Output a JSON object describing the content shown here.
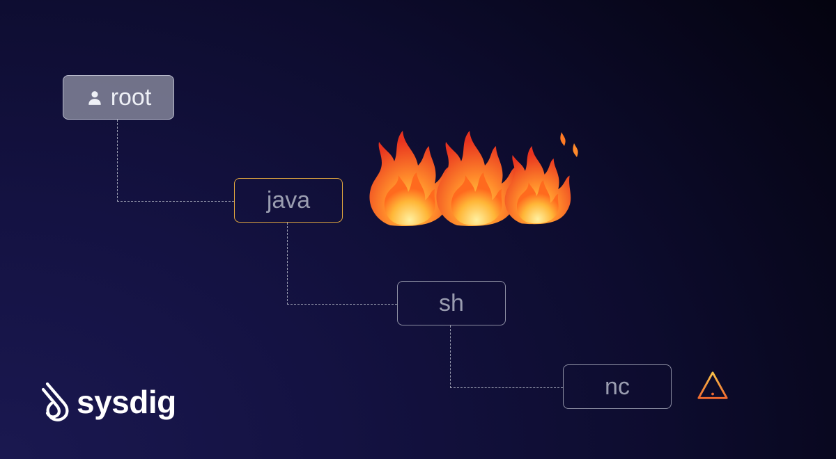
{
  "diagram": {
    "nodes": {
      "root": {
        "label": "root"
      },
      "java": {
        "label": "java"
      },
      "sh": {
        "label": "sh"
      },
      "nc": {
        "label": "nc"
      }
    },
    "icons": {
      "user": "user-icon",
      "fire": "fire-icon",
      "warning": "warning-icon"
    },
    "colors": {
      "background_deep": "#020108",
      "background_light": "#1a1850",
      "node_border_plain": "#8d8fa3",
      "node_border_highlight": "#e3a83f",
      "node_text": "#9a9db0",
      "root_fill": "#9194a5",
      "connector": "#9a9db0",
      "warning_stroke": "#f58a3c",
      "logo_text": "#ffffff"
    }
  },
  "brand": {
    "name": "sysdig"
  }
}
